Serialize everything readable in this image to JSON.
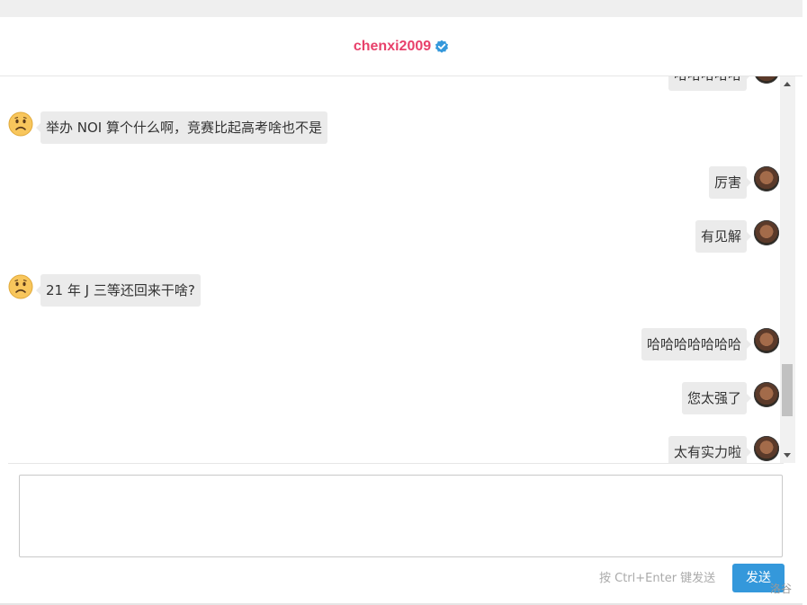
{
  "header": {
    "username": "chenxi2009",
    "verified_icon": "verified-check-icon"
  },
  "messages": [
    {
      "side": "right",
      "text": "哈哈哈哈哈"
    },
    {
      "side": "left",
      "text": "举办 NOI 算个什么啊，竞赛比起高考啥也不是"
    },
    {
      "side": "right",
      "text": "厉害"
    },
    {
      "side": "right",
      "text": "有见解"
    },
    {
      "side": "left",
      "text": "21 年 J 三等还回来干啥?"
    },
    {
      "side": "right",
      "text": "哈哈哈哈哈哈哈"
    },
    {
      "side": "right",
      "text": "您太强了"
    },
    {
      "side": "right",
      "text": "太有实力啦"
    }
  ],
  "composer": {
    "hint": "按 Ctrl+Enter 键发送",
    "send_label": "发送"
  },
  "watermark": "洛谷",
  "colors": {
    "username": "#e8416b",
    "send_button": "#3498db",
    "verified": "#3498db"
  }
}
